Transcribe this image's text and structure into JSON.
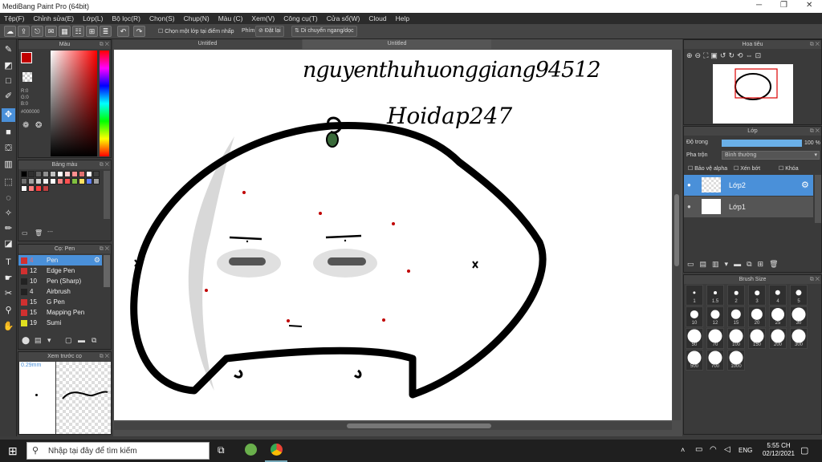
{
  "window": {
    "title": "MediBang Paint Pro (64bit)"
  },
  "menu": [
    "Tệp(F)",
    "Chỉnh sửa(E)",
    "Lớp(L)",
    "Bộ lọc(R)",
    "Chọn(S)",
    "Chụp(N)",
    "Màu (C)",
    "Xem(V)",
    "Công cụ(T)",
    "Cửa sổ(W)",
    "Cloud",
    "Help"
  ],
  "toolbar": {
    "checkbox_label": "Chọn một lớp tại điểm nhấp",
    "pen_label": "Phím",
    "reset_label": "Đặt lại",
    "move_label": "Di chuyển ngang/dọc"
  },
  "color_panel": {
    "title": "Màu",
    "r": "R:0",
    "g": "G:0",
    "b": "B:0",
    "hex": "#000000",
    "foreground": "#c00000"
  },
  "palette_panel": {
    "title": "Bảng màu",
    "footer": "---",
    "swatches": [
      "#000000",
      "#303030",
      "#606060",
      "#909090",
      "#c0c0c0",
      "#ffffff",
      "#ffd0d0",
      "#ff9090",
      "#e07070",
      "#ffffff",
      "#404040",
      "#707070",
      "#a0a0a0",
      "#d0d0d0",
      "#f0f0f0",
      "#ffffff",
      "#f08080",
      "#ff5050",
      "#80c040",
      "#ffe060",
      "#6080ff",
      "#a0a0a0",
      "#ffffff",
      "#ff8080",
      "#ff4040",
      "#c04040"
    ]
  },
  "brush_panel": {
    "title": "Cọ: Pen",
    "brushes": [
      {
        "size": "4",
        "name": "Pen",
        "color": "#d03030",
        "selected": true
      },
      {
        "size": "12",
        "name": "Edge Pen",
        "color": "#d03030",
        "selected": false
      },
      {
        "size": "10",
        "name": "Pen (Sharp)",
        "color": "#222222",
        "selected": false
      },
      {
        "size": "4",
        "name": "Airbrush",
        "color": "#222222",
        "selected": false
      },
      {
        "size": "15",
        "name": "G Pen",
        "color": "#d03030",
        "selected": false
      },
      {
        "size": "15",
        "name": "Mapping Pen",
        "color": "#d03030",
        "selected": false
      },
      {
        "size": "19",
        "name": "Sumi",
        "color": "#e0e020",
        "selected": false
      }
    ]
  },
  "preview_panel": {
    "title": "Xem trước cọ",
    "size": "0.29mm"
  },
  "canvas": {
    "tab_left": "Untitled",
    "tab_right": "Untitled",
    "line1": "nguyenthuhuonggiang94512",
    "line2": "Hoidap247"
  },
  "navigator": {
    "title": "Hoa tiêu"
  },
  "layer_panel": {
    "title": "Lớp",
    "opacity_label": "Độ trong",
    "opacity_value": "100 %",
    "blend_label": "Pha trộn",
    "blend_value": "Bình thường",
    "alpha_label": "Bảo vệ alpha",
    "clip_label": "Xén bớt",
    "lock_label": "Khóa",
    "layers": [
      {
        "name": "Lớp2",
        "selected": true
      },
      {
        "name": "Lớp1",
        "selected": false
      }
    ]
  },
  "brush_size_panel": {
    "title": "Brush Size",
    "sizes": [
      "1",
      "1.5",
      "2",
      "3",
      "4",
      "5",
      "10",
      "12",
      "15",
      "20",
      "25",
      "30",
      "50",
      "70",
      "100",
      "150",
      "200",
      "300",
      "500",
      "700",
      "1000"
    ]
  },
  "taskbar": {
    "search_placeholder": "Nhập tại đây để tìm kiếm",
    "lang": "ENG",
    "time": "5:55 CH",
    "date": "02/12/2021"
  }
}
